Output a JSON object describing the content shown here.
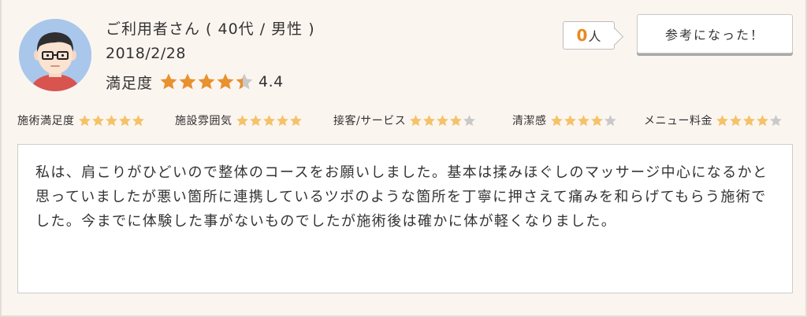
{
  "reviewer": {
    "name": "ご利用者さん ( 40代 / 男性 )",
    "date": "2018/2/28",
    "avatar_icon": "male-with-glasses-avatar"
  },
  "satisfaction": {
    "label": "満足度",
    "rating": 4.4,
    "score_text": "4.4",
    "max": 5
  },
  "helpful": {
    "count": "0",
    "unit": "人",
    "button_label": "参考になった！"
  },
  "categories": [
    {
      "label": "施術満足度",
      "rating": 5
    },
    {
      "label": "施設雰囲気",
      "rating": 5
    },
    {
      "label": "接客/サービス",
      "rating": 4
    },
    {
      "label": "清潔感",
      "rating": 4
    },
    {
      "label": "メニュー料金",
      "rating": 4
    }
  ],
  "comment": "私は、肩こりがひどいので整体のコースをお願いしました。基本は揉みほぐしのマッサージ中心になるかと思っていましたが悪い箇所に連携しているツボのような箇所を丁寧に押さえて痛みを和らげてもらう施術でした。今までに体験した事がないものでしたが施術後は確かに体が軽くなりました。",
  "colors": {
    "star_main": "#e8912e",
    "star_small": "#f4c267",
    "star_empty": "#c9c9c9",
    "accent": "#e78a1e",
    "background": "#fbf5f0"
  }
}
